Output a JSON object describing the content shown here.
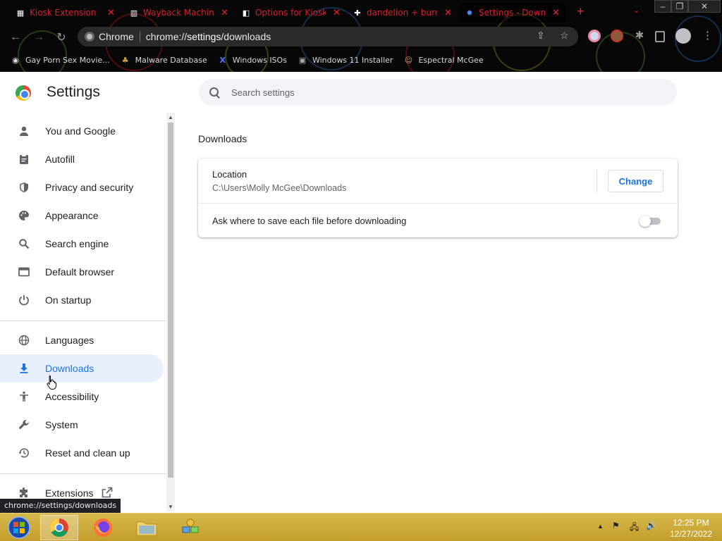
{
  "browser": {
    "tabs": [
      {
        "title": "Kiosk Extension",
        "icon": "extension-page-icon"
      },
      {
        "title": "Wayback Machine",
        "icon": "archive-icon"
      },
      {
        "title": "Options for Kiosk",
        "icon": "options-page-icon"
      },
      {
        "title": "dandelion + burdo",
        "icon": "plus-page-icon"
      },
      {
        "title": "Settings - Downl",
        "icon": "settings-gear-icon",
        "active": true
      }
    ],
    "omnibox": {
      "chip_label": "Chrome",
      "url_prefix": "chrome://",
      "url_host": "settings",
      "url_path": "/downloads"
    },
    "bookmarks": [
      {
        "label": "Gay Porn Sex Movie...",
        "icon": "bookmark-site-icon"
      },
      {
        "label": "Malware Database",
        "icon": "bookmark-malware-icon"
      },
      {
        "label": "Windows ISOs",
        "icon": "bookmark-x-icon"
      },
      {
        "label": "Windows 11 Installer",
        "icon": "bookmark-installer-icon"
      },
      {
        "label": "Espectral McGee",
        "icon": "bookmark-avatar-icon"
      }
    ]
  },
  "settings": {
    "title": "Settings",
    "search_placeholder": "Search settings",
    "nav": [
      {
        "label": "You and Google",
        "icon": "person-icon"
      },
      {
        "label": "Autofill",
        "icon": "clipboard-icon"
      },
      {
        "label": "Privacy and security",
        "icon": "shield-icon"
      },
      {
        "label": "Appearance",
        "icon": "palette-icon"
      },
      {
        "label": "Search engine",
        "icon": "search-icon"
      },
      {
        "label": "Default browser",
        "icon": "browser-window-icon"
      },
      {
        "label": "On startup",
        "icon": "power-icon"
      },
      {
        "label": "Languages",
        "icon": "globe-icon"
      },
      {
        "label": "Downloads",
        "icon": "download-icon",
        "active": true
      },
      {
        "label": "Accessibility",
        "icon": "accessibility-icon"
      },
      {
        "label": "System",
        "icon": "wrench-icon"
      },
      {
        "label": "Reset and clean up",
        "icon": "history-icon"
      },
      {
        "label": "Extensions",
        "icon": "puzzle-icon"
      }
    ],
    "downloads": {
      "section_title": "Downloads",
      "location_label": "Location",
      "location_path": "C:\\Users\\Molly McGee\\Downloads",
      "change_button": "Change",
      "ask_label": "Ask where to save each file before downloading",
      "ask_enabled": false
    }
  },
  "status_bar_url": "chrome://settings/downloads",
  "taskbar": {
    "time": "12:25 PM",
    "date": "12/27/2022"
  },
  "colors": {
    "accent": "#1a73e8",
    "active_nav_bg": "#e8f0fe",
    "taskbar": "#c8a636",
    "tab_text": "#d8202a"
  }
}
